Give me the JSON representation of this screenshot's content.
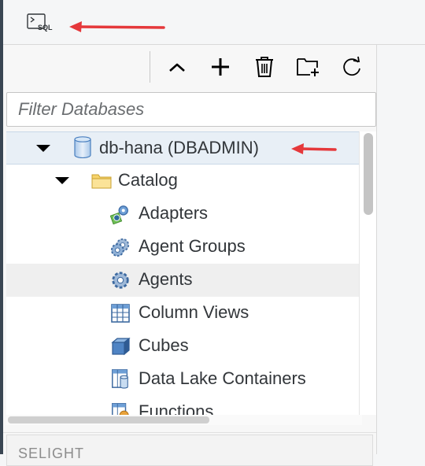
{
  "topbar": {
    "sql_console_label": "SQL"
  },
  "toolbar": {
    "collapse_icon": "chevron-up-icon",
    "add_icon": "plus-icon",
    "delete_icon": "trash-icon",
    "add_folder_icon": "folder-plus-icon",
    "refresh_icon": "refresh-icon"
  },
  "filter": {
    "placeholder": "Filter Databases"
  },
  "tree": {
    "root": {
      "label": "db-hana (DBADMIN)",
      "icon": "database-icon"
    },
    "catalog": {
      "label": "Catalog",
      "icon": "folder-icon"
    },
    "items": [
      {
        "label": "Adapters",
        "icon": "adapter-icon"
      },
      {
        "label": "Agent Groups",
        "icon": "agent-groups-icon"
      },
      {
        "label": "Agents",
        "icon": "gear-icon"
      },
      {
        "label": "Column Views",
        "icon": "table-grid-icon"
      },
      {
        "label": "Cubes",
        "icon": "cube-icon"
      },
      {
        "label": "Data Lake Containers",
        "icon": "container-icon"
      },
      {
        "label": "Functions",
        "icon": "functions-icon"
      }
    ]
  },
  "bottom_panel": {
    "label": "SELIGHT"
  },
  "colors": {
    "annotation_arrow": "#e5383b",
    "selected_row": "#e8eff6",
    "hover_row": "#efefef",
    "icon_blue": "#3b73b9"
  }
}
